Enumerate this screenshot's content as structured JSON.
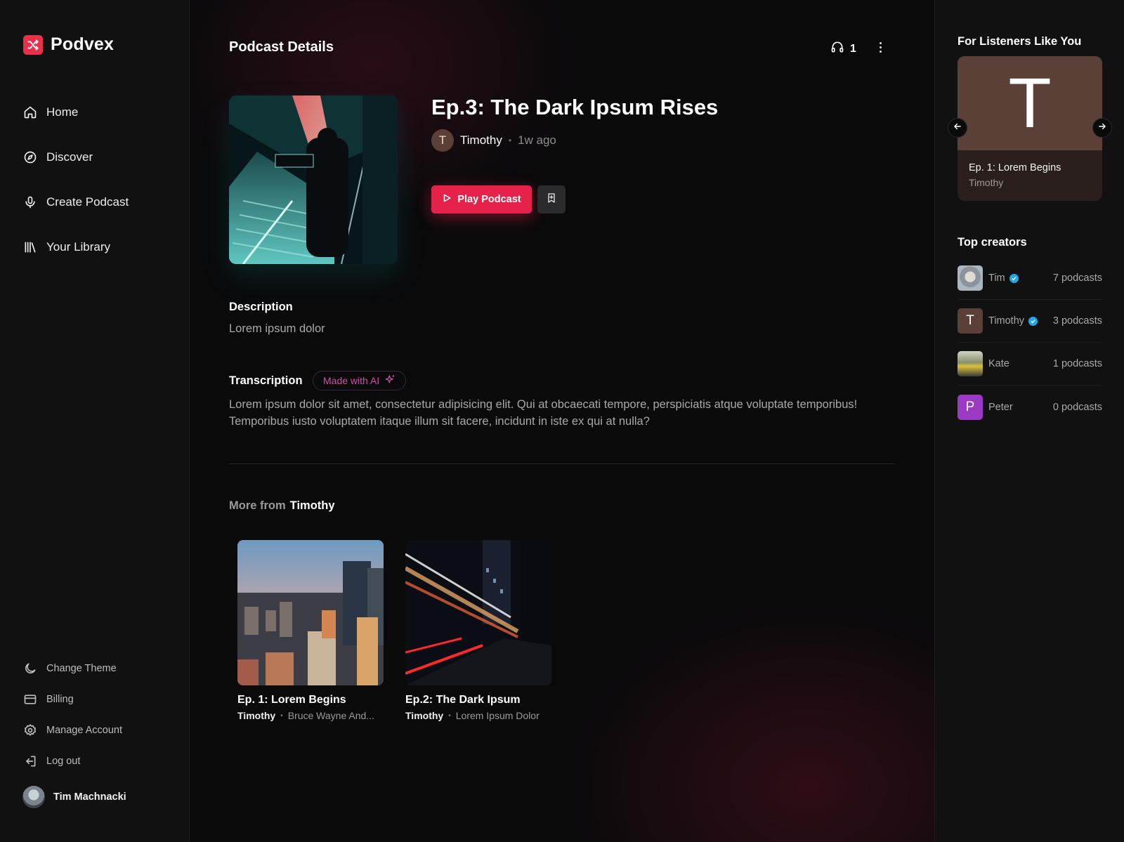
{
  "app": {
    "name": "Podvex",
    "brand_color": "#e4224a"
  },
  "sidebar": {
    "nav": [
      {
        "label": "Home",
        "icon": "home-icon"
      },
      {
        "label": "Discover",
        "icon": "compass-icon"
      },
      {
        "label": "Create Podcast",
        "icon": "microphone-icon"
      },
      {
        "label": "Your Library",
        "icon": "library-icon"
      }
    ],
    "bottom": [
      {
        "label": "Change Theme",
        "icon": "moon-icon"
      },
      {
        "label": "Billing",
        "icon": "credit-card-icon"
      },
      {
        "label": "Manage Account",
        "icon": "gear-icon"
      },
      {
        "label": "Log out",
        "icon": "logout-icon"
      }
    ],
    "user": {
      "name": "Tim Machnacki"
    }
  },
  "header": {
    "title": "Podcast Details",
    "listeners": "1"
  },
  "podcast": {
    "title": "Ep.3: The Dark Ipsum Rises",
    "author_initial": "T",
    "author": "Timothy",
    "time_ago": "1w ago",
    "play_label": "Play Podcast",
    "description_label": "Description",
    "description": "Lorem ipsum dolor",
    "transcription_label": "Transcription",
    "ai_badge": "Made with AI",
    "transcription": "Lorem ipsum dolor sit amet, consectetur adipisicing elit. Qui at obcaecati tempore, perspiciatis atque voluptate temporibus! Temporibus iusto voluptatem itaque illum sit facere, incidunt in iste ex qui at nulla?"
  },
  "more_from": {
    "label": "More from",
    "author": "Timothy",
    "cards": [
      {
        "title": "Ep. 1: Lorem Begins",
        "author": "Timothy",
        "subtitle": "Bruce Wayne And..."
      },
      {
        "title": "Ep.2: The Dark Ipsum",
        "author": "Timothy",
        "subtitle": "Lorem Ipsum Dolor"
      }
    ]
  },
  "right": {
    "recommend_title": "For Listeners Like You",
    "rec": {
      "initial": "T",
      "title": "Ep. 1: Lorem Begins",
      "author": "Timothy"
    },
    "creators_title": "Top creators",
    "creators": [
      {
        "name": "Tim",
        "count": "7 podcasts",
        "verified": true
      },
      {
        "name": "Timothy",
        "count": "3 podcasts",
        "verified": true,
        "initial": "T"
      },
      {
        "name": "Kate",
        "count": "1 podcasts",
        "verified": false
      },
      {
        "name": "Peter",
        "count": "0 podcasts",
        "verified": false,
        "initial": "P"
      }
    ]
  }
}
